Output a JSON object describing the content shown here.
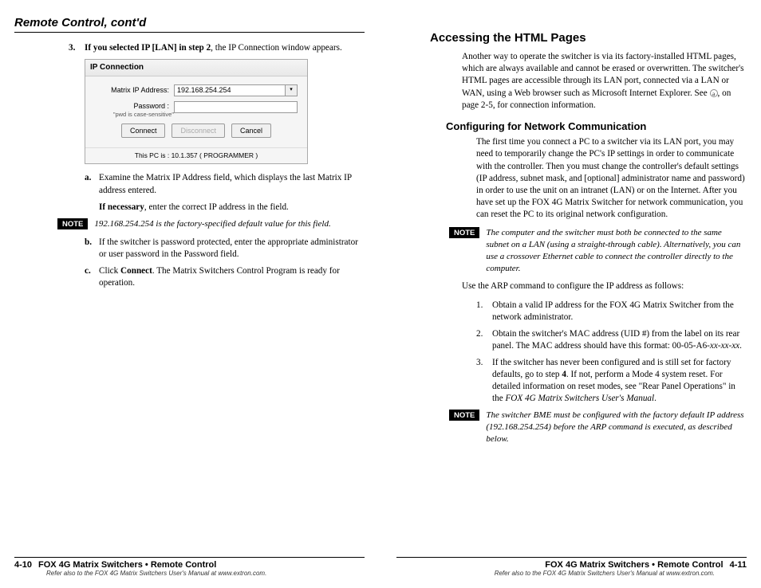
{
  "left": {
    "header": "Remote Control, cont'd",
    "step3": {
      "num": "3.",
      "bold": "If you selected IP [LAN] in step 2",
      "rest": ", the IP Connection window appears."
    },
    "dialog": {
      "title": "IP Connection",
      "ipLabel": "Matrix IP Address:",
      "ipValue": "192.168.254.254",
      "pwLabel": "Password :",
      "pwHint": "\"pwd is case-sensitive\"",
      "btnConnect": "Connect",
      "btnDisconnect": "Disconnect",
      "btnCancel": "Cancel",
      "footer": "This PC is :  10.1.357   ( PROGRAMMER )"
    },
    "subA": {
      "m": "a.",
      "text": "Examine the Matrix IP Address field, which displays the last Matrix IP address entered."
    },
    "subA2": {
      "bold": "If necessary",
      "rest": ", enter the correct IP address in the field."
    },
    "note1": {
      "label": "NOTE",
      "text": "192.168.254.254 is the factory-specified default value for this field."
    },
    "subB": {
      "m": "b.",
      "text": "If the switcher is password protected, enter the appropriate administrator or user password in the Password field."
    },
    "subC": {
      "m": "c.",
      "pre": "Click ",
      "bold": "Connect",
      "post": ".  The Matrix Switchers Control Program is ready for operation."
    }
  },
  "right": {
    "h2": "Accessing the HTML Pages",
    "intro": "Another way to operate the switcher is via its factory-installed HTML pages, which are always available and cannot be erased or overwritten.  The switcher's HTML pages are accessible through its LAN port, connected via a LAN or WAN, using a Web browser such as Microsoft Internet Explorer.  See ",
    "introCircle": "a",
    "introEnd": ", on page 2-5, for connection information.",
    "h3": "Configuring for Network Communication",
    "config": "The first time you connect a PC to a switcher via its LAN port, you may need to temporarily change the PC's IP settings in order to communicate with the controller.  Then you must change the controller's default settings (IP address, subnet mask, and [optional] administrator name and password) in order to use the unit on an intranet (LAN) or on the Internet.  After you have set up the FOX 4G Matrix Switcher for network communication, you can reset the PC to its original network configuration.",
    "note1": {
      "label": "NOTE",
      "text": "The computer and the switcher must both be connected to the same subnet on a LAN (using a straight-through cable).  Alternatively, you can use a crossover Ethernet cable to connect the controller directly to the computer."
    },
    "arp": "Use the ARP command to configure the IP address as follows:",
    "s1": {
      "m": "1.",
      "text": "Obtain a valid IP address for the FOX 4G Matrix Switcher from the network administrator."
    },
    "s2": {
      "m": "2.",
      "pre": "Obtain the switcher's MAC address (UID #) from the label on its rear panel.  The MAC address should have this format: 00-05-A6-",
      "ital": "xx-xx-xx",
      "post": "."
    },
    "s3": {
      "m": "3.",
      "pre1": "If the switcher has never been configured and is still set for factory defaults, go to step ",
      "b1": "4",
      "pre2": ".  If not, perform a Mode 4 system reset.  For detailed information on reset modes, see \"Rear Panel Operations\" in the ",
      "ital": "FOX 4G Matrix Switchers User's Manual",
      "post": "."
    },
    "note2": {
      "label": "NOTE",
      "text": "The switcher BME must be configured with the factory default IP address (192.168.254.254) before the ARP command is executed, as described below."
    }
  },
  "footer": {
    "leftNum": "4-10",
    "rightNum": "4-11",
    "title": "FOX 4G Matrix Switchers • Remote Control",
    "sub": "Refer also to the FOX 4G Matrix Switchers User's Manual at www.extron.com."
  }
}
